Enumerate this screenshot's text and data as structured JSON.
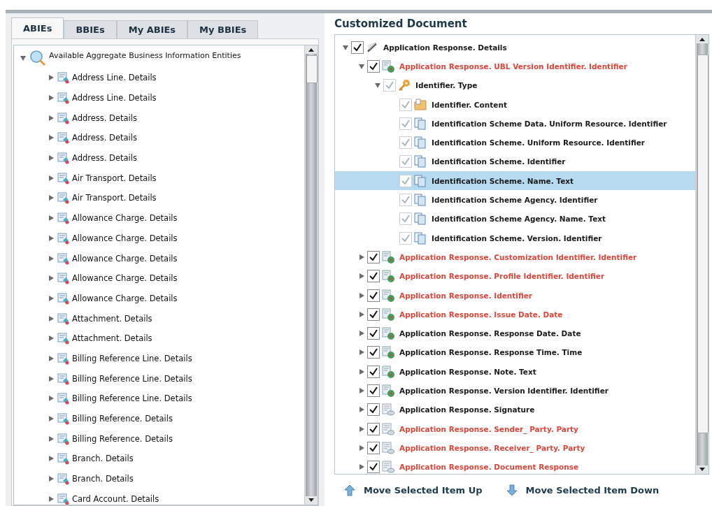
{
  "tabs": [
    {
      "label": "ABIEs",
      "selected": true
    },
    {
      "label": "BBIEs",
      "selected": false
    },
    {
      "label": "My ABIEs",
      "selected": false
    },
    {
      "label": "My BBIEs",
      "selected": false
    }
  ],
  "abie_tree": {
    "label": "Available Aggregate Business Information Entities",
    "expanded": true,
    "children": [
      {
        "label": "Address Line. Details",
        "expanded": false
      },
      {
        "label": "Address Line. Details",
        "expanded": false
      },
      {
        "label": "Address. Details",
        "expanded": false
      },
      {
        "label": "Address. Details",
        "expanded": false
      },
      {
        "label": "Address. Details",
        "expanded": false
      },
      {
        "label": "Air Transport. Details",
        "expanded": false
      },
      {
        "label": "Air Transport. Details",
        "expanded": false
      },
      {
        "label": "Allowance Charge. Details",
        "expanded": false
      },
      {
        "label": "Allowance Charge. Details",
        "expanded": false
      },
      {
        "label": "Allowance Charge. Details",
        "expanded": false
      },
      {
        "label": "Allowance Charge. Details",
        "expanded": false
      },
      {
        "label": "Allowance Charge. Details",
        "expanded": false
      },
      {
        "label": "Attachment. Details",
        "expanded": false
      },
      {
        "label": "Attachment. Details",
        "expanded": false
      },
      {
        "label": "Billing Reference Line. Details",
        "expanded": false
      },
      {
        "label": "Billing Reference Line. Details",
        "expanded": false
      },
      {
        "label": "Billing Reference Line. Details",
        "expanded": false
      },
      {
        "label": "Billing Reference. Details",
        "expanded": false
      },
      {
        "label": "Billing Reference. Details",
        "expanded": false
      },
      {
        "label": "Branch. Details",
        "expanded": false
      },
      {
        "label": "Branch. Details",
        "expanded": false
      },
      {
        "label": "Card Account. Details",
        "expanded": false
      }
    ]
  },
  "document": {
    "title": "Customized Document",
    "tree": [
      {
        "label": "Application Response. Details",
        "kind": "abie",
        "expanded": true,
        "checked": true,
        "disabled": false,
        "color": "#1a1a1a",
        "selected": false,
        "children": [
          {
            "label": "Application Response. UBL Version Identifier. Identifier",
            "kind": "bbie",
            "expanded": true,
            "checked": true,
            "disabled": false,
            "color": "#d9463a",
            "selected": false,
            "children": [
              {
                "label": "Identifier. Type",
                "kind": "type",
                "expanded": true,
                "checked": true,
                "disabled": true,
                "color": "#1a1a1a",
                "selected": false,
                "children": [
                  {
                    "label": "Identifier. Content",
                    "kind": "content",
                    "checked": true,
                    "disabled": true,
                    "color": "#1a1a1a",
                    "selected": false
                  },
                  {
                    "label": "Identification Scheme Data. Uniform Resource. Identifier",
                    "kind": "attribute",
                    "checked": true,
                    "disabled": true,
                    "color": "#1a1a1a",
                    "selected": false
                  },
                  {
                    "label": "Identification Scheme. Uniform Resource. Identifier",
                    "kind": "attribute",
                    "checked": true,
                    "disabled": true,
                    "color": "#1a1a1a",
                    "selected": false
                  },
                  {
                    "label": "Identification Scheme. Identifier",
                    "kind": "attribute",
                    "checked": true,
                    "disabled": true,
                    "color": "#1a1a1a",
                    "selected": false
                  },
                  {
                    "label": "Identification Scheme. Name. Text",
                    "kind": "attribute",
                    "checked": true,
                    "disabled": true,
                    "color": "#1a1a1a",
                    "selected": true
                  },
                  {
                    "label": "Identification Scheme Agency. Identifier",
                    "kind": "attribute",
                    "checked": true,
                    "disabled": true,
                    "color": "#1a1a1a",
                    "selected": false
                  },
                  {
                    "label": "Identification Scheme Agency. Name. Text",
                    "kind": "attribute",
                    "checked": true,
                    "disabled": true,
                    "color": "#1a1a1a",
                    "selected": false
                  },
                  {
                    "label": "Identification Scheme. Version. Identifier",
                    "kind": "attribute",
                    "checked": true,
                    "disabled": true,
                    "color": "#1a1a1a",
                    "selected": false
                  }
                ]
              }
            ]
          },
          {
            "label": "Application Response. Customization Identifier. Identifier",
            "kind": "bbie",
            "expanded": false,
            "checked": true,
            "disabled": false,
            "color": "#d9463a",
            "selected": false
          },
          {
            "label": "Application Response. Profile Identifier. Identifier",
            "kind": "bbie",
            "expanded": false,
            "checked": true,
            "disabled": false,
            "color": "#d9463a",
            "selected": false
          },
          {
            "label": "Application Response. Identifier",
            "kind": "bbie",
            "expanded": false,
            "checked": true,
            "disabled": false,
            "color": "#d9463a",
            "selected": false
          },
          {
            "label": "Application Response. Issue Date. Date",
            "kind": "bbie",
            "expanded": false,
            "checked": true,
            "disabled": false,
            "color": "#d9463a",
            "selected": false
          },
          {
            "label": "Application Response. Response Date. Date",
            "kind": "bbie",
            "expanded": false,
            "checked": true,
            "disabled": false,
            "color": "#1a1a1a",
            "selected": false
          },
          {
            "label": "Application Response. Response Time. Time",
            "kind": "bbie",
            "expanded": false,
            "checked": true,
            "disabled": false,
            "color": "#1a1a1a",
            "selected": false
          },
          {
            "label": "Application Response. Note. Text",
            "kind": "bbie",
            "expanded": false,
            "checked": true,
            "disabled": false,
            "color": "#1a1a1a",
            "selected": false
          },
          {
            "label": "Application Response. Version Identifier. Identifier",
            "kind": "bbie",
            "expanded": false,
            "checked": true,
            "disabled": false,
            "color": "#1a1a1a",
            "selected": false
          },
          {
            "label": "Application Response. Signature",
            "kind": "asbie",
            "expanded": false,
            "checked": true,
            "disabled": false,
            "color": "#1a1a1a",
            "selected": false
          },
          {
            "label": "Application Response. Sender_ Party. Party",
            "kind": "asbie",
            "expanded": false,
            "checked": true,
            "disabled": false,
            "color": "#d9463a",
            "selected": false
          },
          {
            "label": "Application Response. Receiver_ Party. Party",
            "kind": "asbie",
            "expanded": false,
            "checked": true,
            "disabled": false,
            "color": "#d9463a",
            "selected": false
          },
          {
            "label": "Application Response. Document Response",
            "kind": "asbie",
            "expanded": false,
            "checked": true,
            "disabled": false,
            "color": "#d9463a",
            "selected": false
          }
        ]
      }
    ]
  },
  "buttons": [
    {
      "label": "Move Selected Item Up",
      "kind": "up"
    },
    {
      "label": "Move Selected Item Down",
      "kind": "down"
    }
  ]
}
